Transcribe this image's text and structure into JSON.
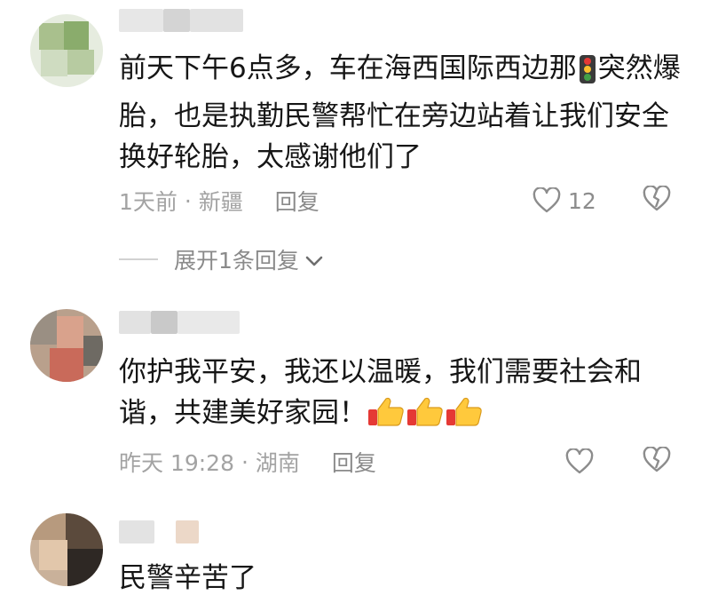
{
  "comments": [
    {
      "text_parts": [
        "前天下午6点多，车在海西国际西边那",
        "突然爆胎，也是执勤民警帮忙在旁边站着让我们安全换好轮胎，太感谢他们了"
      ],
      "text_icon": "traffic-light-icon",
      "time": "1天前",
      "location": "新疆",
      "reply_label": "回复",
      "likes": "12",
      "expand_label": "展开1条回复"
    },
    {
      "text": "你护我平安，我还以温暖，我们需要社会和谐，共建美好家园！",
      "text_icon": "thumbs-up-icon",
      "text_icon_count": 3,
      "time": "昨天 19:28",
      "location": "湖南",
      "reply_label": "回复"
    },
    {
      "text": "民警辛苦了"
    }
  ],
  "separator": " · ",
  "colors": {
    "text": "#161616",
    "meta": "#a3a3a3",
    "icon": "#8c8c8c"
  }
}
